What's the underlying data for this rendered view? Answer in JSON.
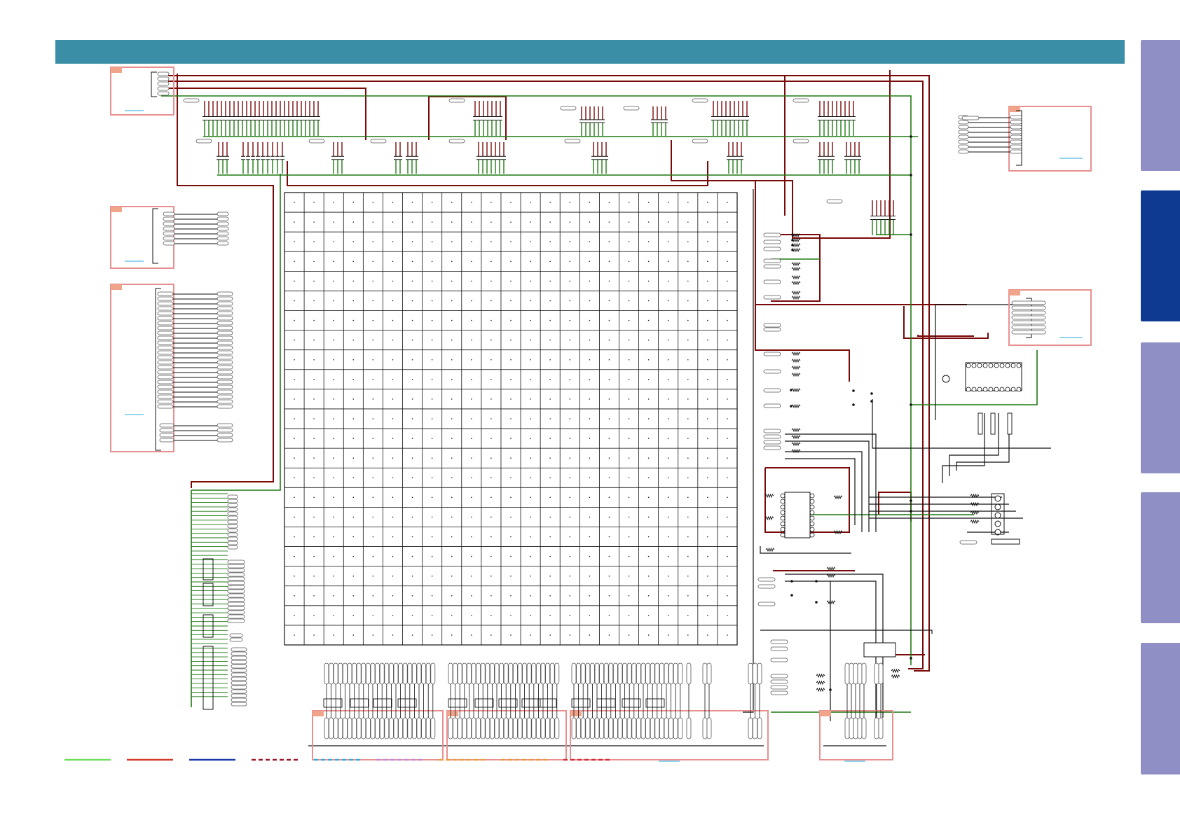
{
  "header": {
    "title": "",
    "color": "#3a8ea6"
  },
  "side_tabs": [
    {
      "label": "",
      "active": false
    },
    {
      "label": "",
      "active": true
    },
    {
      "label": "",
      "active": false
    },
    {
      "label": "",
      "active": false
    },
    {
      "label": "",
      "active": false
    }
  ],
  "colors": {
    "tab_inactive": "#8f8fc6",
    "tab_active": "#0f3a92",
    "wire_red": "#7a0a0a",
    "wire_green": "#1f7a12",
    "wire_black": "#111111",
    "block_outline": "#e89090",
    "block_tag": "#f0a48a",
    "link_blue": "#2aa8d8"
  },
  "legend": [
    {
      "style": "solid",
      "color": "#6ee05a"
    },
    {
      "style": "solid",
      "color": "#d23a2a"
    },
    {
      "style": "solid",
      "color": "#1c3aa8"
    },
    {
      "style": "dashed",
      "color": "#9a1a2a"
    },
    {
      "style": "dashed",
      "color": "#39a9dc"
    },
    {
      "style": "dashed",
      "color": "#c08ad8"
    },
    {
      "style": "dashed",
      "color": "#e8a040"
    },
    {
      "style": "dashed",
      "color": "#e89a40"
    },
    {
      "style": "dashed",
      "color": "#d0303a"
    }
  ],
  "main_chip": {
    "pin_grid_rows": 23,
    "pin_grid_cols": 23
  }
}
